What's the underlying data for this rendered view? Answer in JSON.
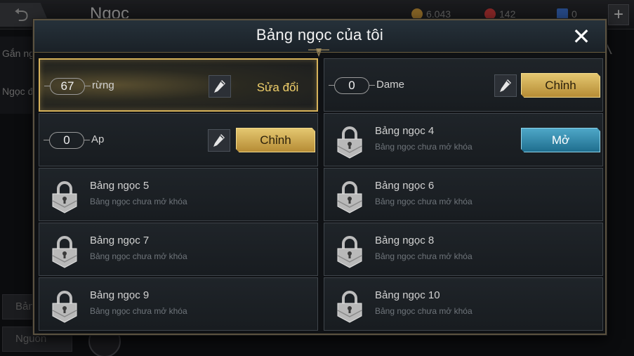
{
  "background": {
    "title": "Ngọc",
    "currencies": [
      {
        "value": "6.043",
        "color": "#c8953a"
      },
      {
        "value": "142",
        "color": "#c83a3a"
      },
      {
        "value": "0",
        "color": "#3a6ec8"
      }
    ],
    "plus_label": "+",
    "left_texts": [
      "Gắn ngọc",
      "Ngọc đ"
    ],
    "bottom_buttons": [
      "Bảng",
      "Nguồn"
    ]
  },
  "modal": {
    "title": "Bảng ngọc của tôi",
    "close_label": "✕"
  },
  "pages": [
    {
      "number": "67",
      "name": "rừng",
      "action": "Sửa đổi",
      "state": "selected"
    },
    {
      "number": "0",
      "name": "Dame",
      "action": "Chỉnh",
      "state": "unlocked"
    },
    {
      "number": "0",
      "name": "Ap",
      "action": "Chỉnh",
      "state": "unlocked"
    },
    {
      "title": "Bảng ngọc 4",
      "subtitle": "Bảng ngọc chưa mở khóa",
      "action": "Mở",
      "state": "unlockable"
    },
    {
      "title": "Bảng ngọc 5",
      "subtitle": "Bảng ngọc chưa mở khóa",
      "state": "locked"
    },
    {
      "title": "Bảng ngọc 6",
      "subtitle": "Bảng ngọc chưa mở khóa",
      "state": "locked"
    },
    {
      "title": "Bảng ngọc 7",
      "subtitle": "Bảng ngọc chưa mở khóa",
      "state": "locked"
    },
    {
      "title": "Bảng ngọc 8",
      "subtitle": "Bảng ngọc chưa mở khóa",
      "state": "locked"
    },
    {
      "title": "Bảng ngọc 9",
      "subtitle": "Bảng ngọc chưa mở khóa",
      "state": "locked"
    },
    {
      "title": "Bảng ngọc 10",
      "subtitle": "Bảng ngọc chưa mở khóa",
      "state": "locked"
    }
  ],
  "icons": {
    "edit": "pencil-icon",
    "lock": "padlock-icon",
    "close": "close-icon"
  },
  "colors": {
    "gold": "#d6b25a",
    "blue": "#2f8fb5"
  }
}
